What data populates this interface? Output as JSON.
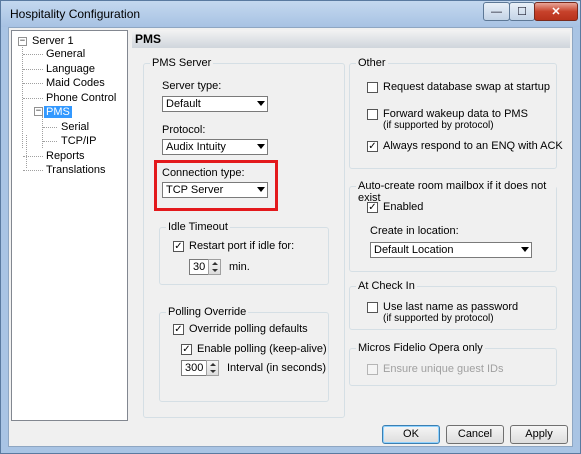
{
  "window": {
    "title": "Hospitality Configuration",
    "minimize_glyph": "—",
    "maximize_glyph": "☐",
    "close_glyph": "✕"
  },
  "tree": {
    "root": {
      "label": "Server 1",
      "expander": "−"
    },
    "items": [
      {
        "label": "General"
      },
      {
        "label": "Language"
      },
      {
        "label": "Maid Codes"
      },
      {
        "label": "Phone Control"
      },
      {
        "label": "PMS",
        "expander": "−",
        "selected": true
      },
      {
        "label": "Serial"
      },
      {
        "label": "TCP/IP"
      },
      {
        "label": "Reports"
      },
      {
        "label": "Translations"
      }
    ]
  },
  "panel": {
    "title": "PMS",
    "pms_server": {
      "title": "PMS Server",
      "server_type_label": "Server type:",
      "server_type_value": "Default",
      "protocol_label": "Protocol:",
      "protocol_value": "Audix Intuity",
      "connection_type_label": "Connection type:",
      "connection_type_value": "TCP Server",
      "idle_timeout": {
        "title": "Idle Timeout",
        "restart_label": "Restart port if idle for:",
        "restart_checked": true,
        "minutes_value": "30",
        "minutes_unit": "min."
      },
      "polling_override": {
        "title": "Polling Override",
        "override_label": "Override polling defaults",
        "override_checked": true,
        "enable_label": "Enable polling (keep-alive)",
        "enable_checked": true,
        "interval_value": "300",
        "interval_label": "Interval (in seconds)"
      }
    },
    "other": {
      "title": "Other",
      "request_swap_label": "Request database swap at startup",
      "request_swap_checked": false,
      "forward_wakeup_label": "Forward wakeup data to PMS",
      "forward_wakeup_sub": "(if supported by protocol)",
      "forward_wakeup_checked": false,
      "always_respond_label": "Always respond to an ENQ with ACK",
      "always_respond_checked": true
    },
    "auto_create": {
      "title": "Auto-create room mailbox if it does not exist",
      "enabled_label": "Enabled",
      "enabled_checked": true,
      "location_label": "Create in location:",
      "location_value": "Default Location"
    },
    "check_in": {
      "title": "At Check In",
      "last_name_label": "Use last name as password",
      "last_name_sub": "(if supported by protocol)",
      "last_name_checked": false
    },
    "fidelio": {
      "title": "Micros Fidelio Opera only",
      "unique_ids_label": "Ensure unique guest IDs",
      "unique_ids_checked": false
    }
  },
  "buttons": {
    "ok": "OK",
    "cancel": "Cancel",
    "apply": "Apply"
  },
  "glyphs": {
    "checked": "✓",
    "unchecked": ""
  },
  "colors": {
    "highlight": "#e3191c",
    "selection": "#3399ff"
  }
}
